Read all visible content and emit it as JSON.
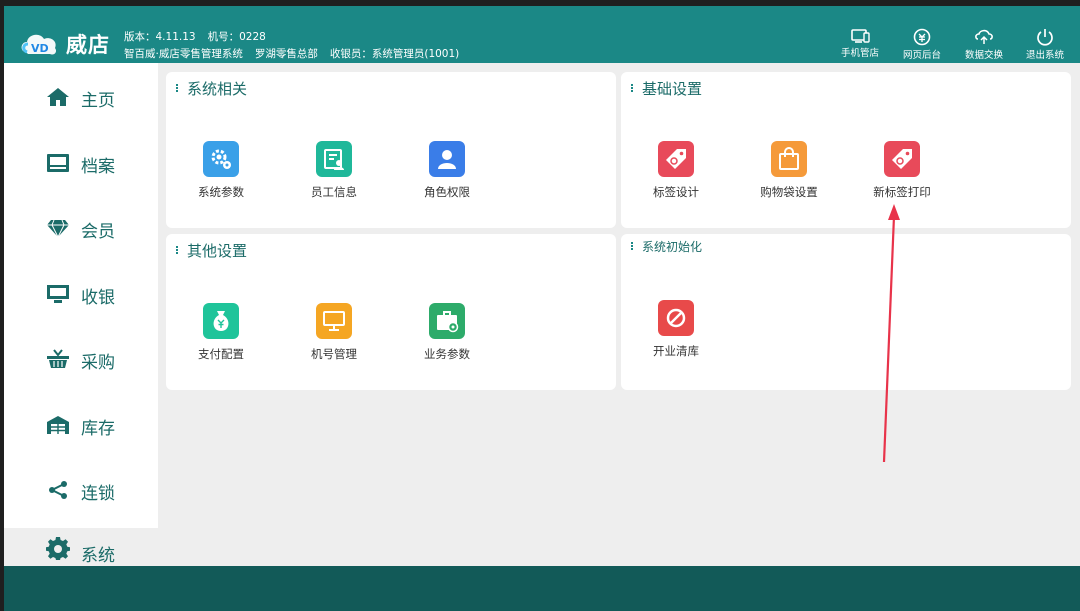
{
  "header": {
    "brand": "威店",
    "version": "版本：4.11.13",
    "machine_no": "机号：0228",
    "system_name": "智百威·威店零售管理系统",
    "store": "罗湖零售总部",
    "cashier": "收银员：系统管理员(1001)",
    "buttons": [
      "手机管店",
      "网页后台",
      "数据交换",
      "退出系统"
    ],
    "color": "#1b8886"
  },
  "sidebar": {
    "items": [
      {
        "label": "主页",
        "icon": "home-icon"
      },
      {
        "label": "档案",
        "icon": "archive-icon"
      },
      {
        "label": "会员",
        "icon": "diamond-icon"
      },
      {
        "label": "收银",
        "icon": "monitor-icon"
      },
      {
        "label": "采购",
        "icon": "basket-icon"
      },
      {
        "label": "库存",
        "icon": "warehouse-icon"
      },
      {
        "label": "连锁",
        "icon": "share-icon"
      },
      {
        "label": "系统",
        "icon": "gear-icon"
      }
    ],
    "active": "系统"
  },
  "panels": {
    "system_related": {
      "title": "系统相关",
      "items": [
        {
          "label": "系统参数",
          "icon": "settings-icon",
          "color": "#3aa0e8"
        },
        {
          "label": "员工信息",
          "icon": "employee-icon",
          "color": "#1fb89a"
        },
        {
          "label": "角色权限",
          "icon": "user-icon",
          "color": "#3a7de8"
        }
      ]
    },
    "basic_settings": {
      "title": "基础设置",
      "items": [
        {
          "label": "标签设计",
          "icon": "tag-icon",
          "color": "#e84a5a"
        },
        {
          "label": "购物袋设置",
          "icon": "bag-icon",
          "color": "#f59a3a"
        },
        {
          "label": "新标签打印",
          "icon": "tag-icon",
          "color": "#e84a5a"
        }
      ]
    },
    "other_settings": {
      "title": "其他设置",
      "items": [
        {
          "label": "支付配置",
          "icon": "money-bag-icon",
          "color": "#1fc49a"
        },
        {
          "label": "机号管理",
          "icon": "monitor-icon",
          "color": "#f5a623"
        },
        {
          "label": "业务参数",
          "icon": "briefcase-icon",
          "color": "#2dab6a"
        }
      ]
    },
    "system_init": {
      "title": "系统初始化",
      "items": [
        {
          "label": "开业清库",
          "icon": "forbidden-icon",
          "color": "#e84a4a"
        }
      ]
    }
  },
  "annotation_color": "#e8334a"
}
